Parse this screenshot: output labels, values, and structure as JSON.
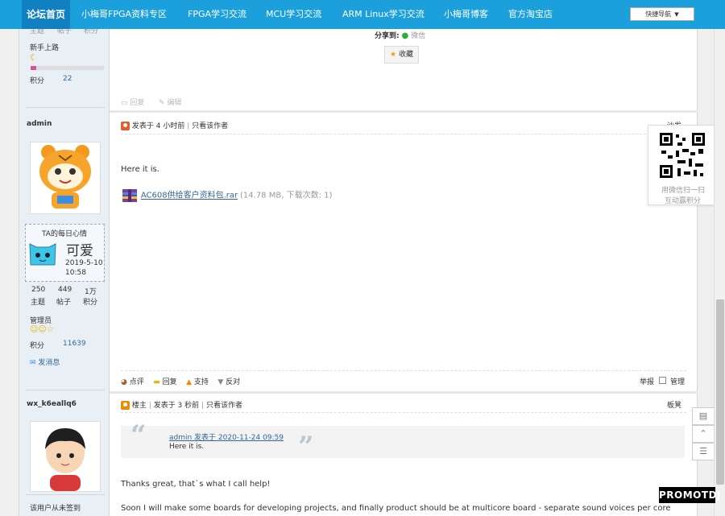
{
  "nav": {
    "home": "论坛首页",
    "items": [
      "小梅哥FPGA资料专区",
      "FPGA学习交流",
      "MCU学习交流",
      "ARM Linux学习交流",
      "小梅哥博客",
      "官方淘宝店"
    ],
    "quick_nav": "快捷导航"
  },
  "left": {
    "user1": {
      "stats_labels": [
        "主题",
        "帖子",
        "积分"
      ],
      "rank": "新手上路",
      "credit_label": "积分",
      "credit_value": "22",
      "rank_progress_pct": 8
    },
    "user2": {
      "name": "admin",
      "mood_title": "TA的每日心情",
      "mood_text": "可爱",
      "mood_date": "2019-5-10",
      "mood_time": "10:58",
      "stats": [
        {
          "value": "250",
          "label": "主题"
        },
        {
          "value": "449",
          "label": "帖子"
        },
        {
          "value": "1万",
          "label": "积分"
        }
      ],
      "rank": "管理员",
      "credit_label": "积分",
      "credit_value": "11639",
      "message": "发消息"
    },
    "user3": {
      "name": "wx_k6eallq6",
      "footer": "该用户从未签到"
    }
  },
  "post1": {
    "share_label": "分享到:",
    "share_target": "微信",
    "favorite": "收藏",
    "reply": "回复",
    "edit": "编辑"
  },
  "post2": {
    "posted": "发表于 4 小时前",
    "only_author": "只看该作者",
    "floor": "沙发",
    "body": "Here it is.",
    "attachment_name": "AC608供给客户资料包.rar",
    "attachment_meta": "(14.78 MB, 下载次数: 1)",
    "actions": [
      "点评",
      "回复",
      "支持",
      "反对"
    ],
    "report": "举报",
    "manage": "管理"
  },
  "post3": {
    "owner_tag": "楼主",
    "posted": "发表于 3 秒前",
    "only_author": "只看该作者",
    "floor": "板凳",
    "quote_author": "admin 发表于 2020-11-24 09:59",
    "quote_body": "Here it is.",
    "line1": "Thanks great, that`s what I call help!",
    "line2": "Soon I will make some boards for developing projects, and finally product should be at multicore board - separate sound voices per core"
  },
  "qr": {
    "line1": "用微信扫一扫",
    "line2": "互动赢积分"
  },
  "watermark": "PROMOTDJ",
  "colors": {
    "nav_bg": "#1ca0dc",
    "nav_active": "#1080c0",
    "link": "#336699"
  }
}
